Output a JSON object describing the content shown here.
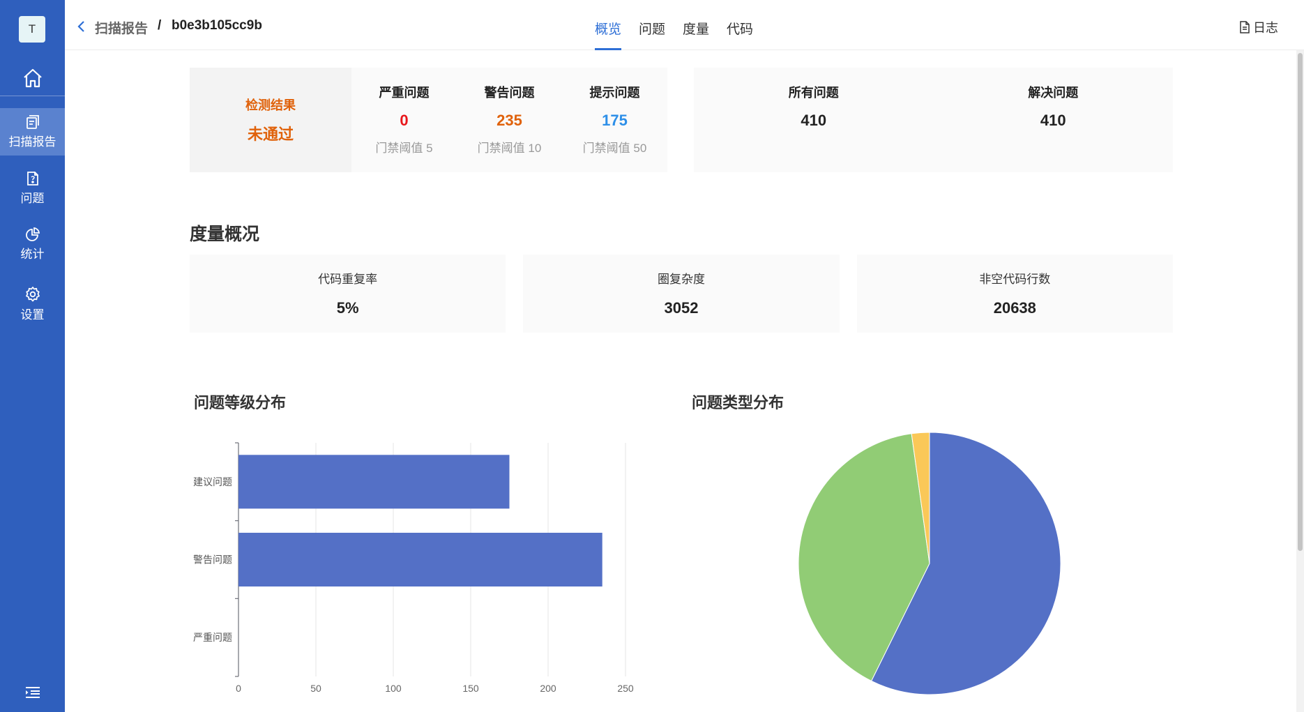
{
  "sidebar": {
    "avatar": "T",
    "items": [
      {
        "label": "扫描报告",
        "icon": "report-icon"
      },
      {
        "label": "问题",
        "icon": "issue-file-icon"
      },
      {
        "label": "统计",
        "icon": "pie-chart-icon"
      },
      {
        "label": "设置",
        "icon": "gear-icon"
      }
    ]
  },
  "header": {
    "breadcrumb_parent": "扫描报告",
    "separator": "/",
    "breadcrumb_current": "b0e3b105cc9b",
    "tabs": [
      "概览",
      "问题",
      "度量",
      "代码"
    ],
    "log_label": "日志"
  },
  "summary": {
    "result_title": "检测结果",
    "result_value": "未通过",
    "stats": [
      {
        "title": "严重问题",
        "value": "0",
        "threshold": "门禁阈值 5",
        "color": "#e8171b"
      },
      {
        "title": "警告问题",
        "value": "235",
        "threshold": "门禁阈值 10",
        "color": "#e0620b"
      },
      {
        "title": "提示问题",
        "value": "175",
        "threshold": "门禁阈值 50",
        "color": "#2d8fe8"
      }
    ],
    "totals": [
      {
        "title": "所有问题",
        "value": "410"
      },
      {
        "title": "解决问题",
        "value": "410"
      }
    ]
  },
  "metrics_section": {
    "title": "度量概况",
    "items": [
      {
        "label": "代码重复率",
        "value": "5%"
      },
      {
        "label": "圈复杂度",
        "value": "3052"
      },
      {
        "label": "非空代码行数",
        "value": "20638"
      }
    ]
  },
  "charts": {
    "level_title": "问题等级分布",
    "type_title": "问题类型分布"
  },
  "chart_data": [
    {
      "type": "bar",
      "orientation": "horizontal",
      "title": "问题等级分布",
      "categories": [
        "建议问题",
        "警告问题",
        "严重问题"
      ],
      "values": [
        175,
        235,
        0
      ],
      "xlim": [
        0,
        250
      ],
      "xticks": [
        0,
        50,
        100,
        150,
        200,
        250
      ],
      "grid": true,
      "color": "#5470c6"
    },
    {
      "type": "pie",
      "title": "问题类型分布",
      "values": [
        235,
        166,
        9
      ],
      "colors": [
        "#5470c6",
        "#91cc75",
        "#fac858"
      ]
    }
  ]
}
